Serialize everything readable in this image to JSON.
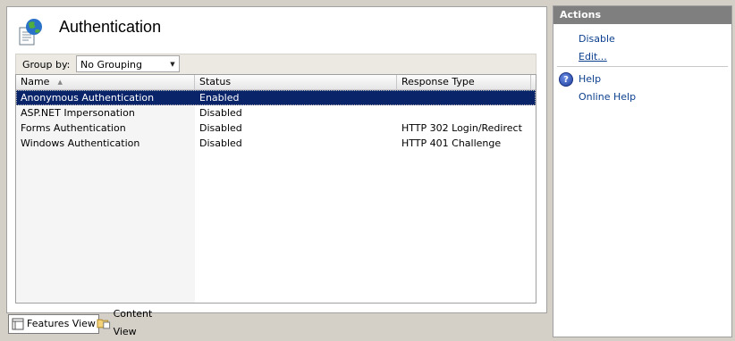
{
  "page": {
    "title": "Authentication"
  },
  "group_by": {
    "label": "Group by:",
    "value": "No Grouping"
  },
  "grid": {
    "columns": [
      "Name",
      "Status",
      "Response Type"
    ],
    "rows": [
      {
        "name": "Anonymous Authentication",
        "status": "Enabled",
        "response_type": "",
        "selected": true
      },
      {
        "name": "ASP.NET Impersonation",
        "status": "Disabled",
        "response_type": ""
      },
      {
        "name": "Forms Authentication",
        "status": "Disabled",
        "response_type": "HTTP 302 Login/Redirect"
      },
      {
        "name": "Windows Authentication",
        "status": "Disabled",
        "response_type": "HTTP 401 Challenge"
      }
    ]
  },
  "view_tabs": {
    "features": "Features View",
    "content": "Content View",
    "active": "features"
  },
  "actions": {
    "title": "Actions",
    "items": [
      "Disable",
      "Edit...",
      "Help",
      "Online Help"
    ]
  },
  "colors": {
    "selection": "#0a246a",
    "link": "#0b3f8e",
    "actions_header": "#7f7f7f"
  },
  "icons": [
    "authentication-globe-icon",
    "sort-ascending-icon",
    "dropdown-arrow-icon",
    "features-view-icon",
    "content-view-icon",
    "help-icon"
  ]
}
